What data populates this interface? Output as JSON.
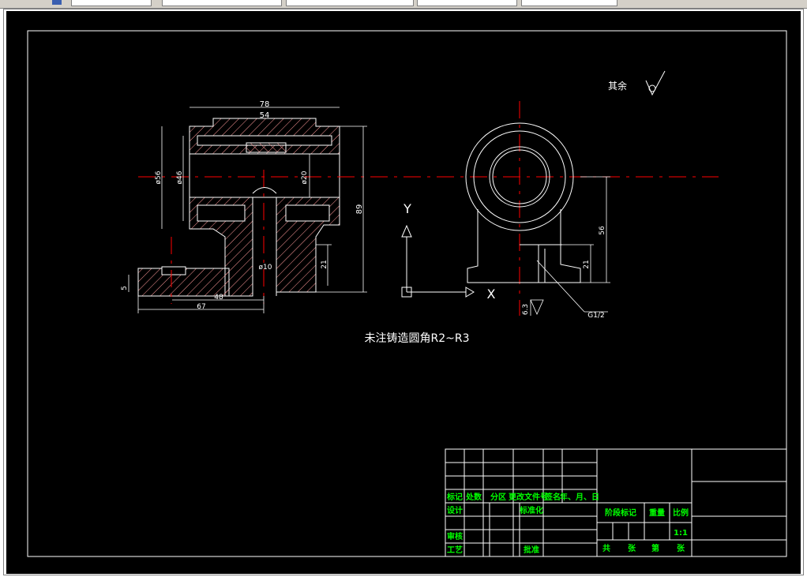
{
  "app": {
    "toolbar": {
      "fields": [
        "",
        "",
        "",
        "",
        ""
      ]
    }
  },
  "drawing": {
    "surface_finish_note": "其余",
    "fillet_note": "未注铸造圆角R2~R3",
    "axis_labels": {
      "y": "Y",
      "x": "X"
    },
    "dimensions": {
      "d78": "78",
      "d54": "54",
      "dia56": "ø56",
      "dia46": "ø46",
      "dia20": "ø20",
      "d89": "89",
      "dia10": "ø10",
      "d21_left": "21",
      "d5": "5",
      "d48": "48",
      "d67": "67",
      "d56": "56",
      "d21_right": "21",
      "roughness": "6.3",
      "thread": "G1/2"
    }
  },
  "title_block": {
    "headers": [
      "标记",
      "处数",
      "分区",
      "更改文件号",
      "签名",
      "年、月、日"
    ],
    "design": "设计",
    "standardization": "标准化",
    "stage_mark": "阶段标记",
    "weight": "重量",
    "scale_label": "比例",
    "scale_value": "1:1",
    "review": "审核",
    "process": "工艺",
    "approve": "批准",
    "total": "共",
    "sheets": "张",
    "sheet_no": "第",
    "sheet_unit": "张"
  },
  "colors": {
    "background": "#000000",
    "linework": "#ffffff",
    "centerline": "#ff0000",
    "hatch": "#ff9999",
    "title_text": "#00ff00",
    "toolbar": "#d4d0c8"
  }
}
